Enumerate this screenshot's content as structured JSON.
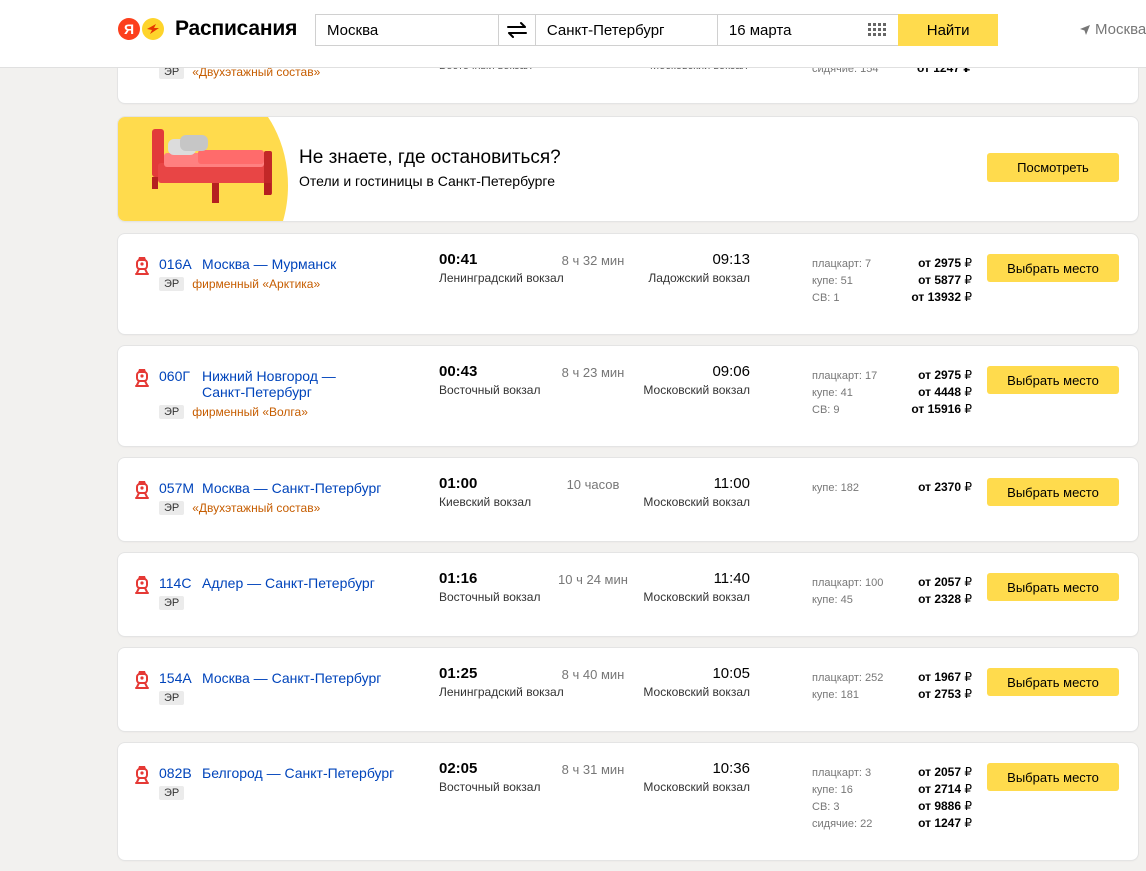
{
  "header": {
    "logo_letter": "Я",
    "logo_text": "Расписания",
    "from_value": "Москва",
    "to_value": "Санкт-Петербург",
    "date_value": "16 марта",
    "find_label": "Найти",
    "geo_label": "Москва"
  },
  "partial_card": {
    "er": "ЭР",
    "brand": "«Двухэтажный состав»",
    "dep_station": "Восточный вокзал",
    "arr_station": "Московский вокзал",
    "class_info": "сидячие: 154",
    "price": "от 1247 ₽"
  },
  "banner": {
    "title": "Не знаете, где остановиться?",
    "subtitle": "Отели и гостиницы в Санкт-Петербурге",
    "button": "Посмотреть"
  },
  "currency": "₽",
  "button_label": "Выбрать место",
  "trains": [
    {
      "number": "016А",
      "route": "Москва — Мурманск",
      "er": "ЭР",
      "brand": "фирменный «Арктика»",
      "dep_time": "00:41",
      "dep_station": "Ленинградский вокзал",
      "duration": "8 ч 32 мин",
      "arr_time": "09:13",
      "arr_station": "Ладожский вокзал",
      "classes": [
        "плацкарт: 7",
        "купе: 51",
        "СВ: 1"
      ],
      "prices": [
        "от 2975",
        "от 5877",
        "от 13932"
      ]
    },
    {
      "number": "060Г",
      "route": "Нижний Новгород — Санкт-Петербург",
      "er": "ЭР",
      "brand": "фирменный «Волга»",
      "dep_time": "00:43",
      "dep_station": "Восточный вокзал",
      "duration": "8 ч 23 мин",
      "arr_time": "09:06",
      "arr_station": "Московский вокзал",
      "classes": [
        "плацкарт: 17",
        "купе: 41",
        "СВ: 9"
      ],
      "prices": [
        "от 2975",
        "от 4448",
        "от 15916"
      ]
    },
    {
      "number": "057М",
      "route": "Москва — Санкт-Петербург",
      "er": "ЭР",
      "brand": "«Двухэтажный состав»",
      "dep_time": "01:00",
      "dep_station": "Киевский вокзал",
      "duration": "10 часов",
      "arr_time": "11:00",
      "arr_station": "Московский вокзал",
      "classes": [
        "купе: 182"
      ],
      "prices": [
        "от 2370"
      ]
    },
    {
      "number": "114С",
      "route": "Адлер — Санкт-Петербург",
      "er": "ЭР",
      "brand": "",
      "dep_time": "01:16",
      "dep_station": "Восточный вокзал",
      "duration": "10 ч 24 мин",
      "arr_time": "11:40",
      "arr_station": "Московский вокзал",
      "classes": [
        "плацкарт: 100",
        "купе: 45"
      ],
      "prices": [
        "от 2057",
        "от 2328"
      ]
    },
    {
      "number": "154А",
      "route": "Москва — Санкт-Петербург",
      "er": "ЭР",
      "brand": "",
      "dep_time": "01:25",
      "dep_station": "Ленинградский вокзал",
      "duration": "8 ч 40 мин",
      "arr_time": "10:05",
      "arr_station": "Московский вокзал",
      "classes": [
        "плацкарт: 252",
        "купе: 181"
      ],
      "prices": [
        "от 1967",
        "от 2753"
      ]
    },
    {
      "number": "082В",
      "route": "Белгород — Санкт-Петербург",
      "er": "ЭР",
      "brand": "",
      "dep_time": "02:05",
      "dep_station": "Восточный вокзал",
      "duration": "8 ч 31 мин",
      "arr_time": "10:36",
      "arr_station": "Московский вокзал",
      "classes": [
        "плацкарт: 3",
        "купе: 16",
        "СВ: 3",
        "сидячие: 22"
      ],
      "prices": [
        "от 2057",
        "от 2714",
        "от 9886",
        "от 1247"
      ]
    }
  ],
  "colors": {
    "accent": "#ffdb4d",
    "link": "#0044bb",
    "brand": "#c65d00",
    "train_icon": "#e53935"
  }
}
